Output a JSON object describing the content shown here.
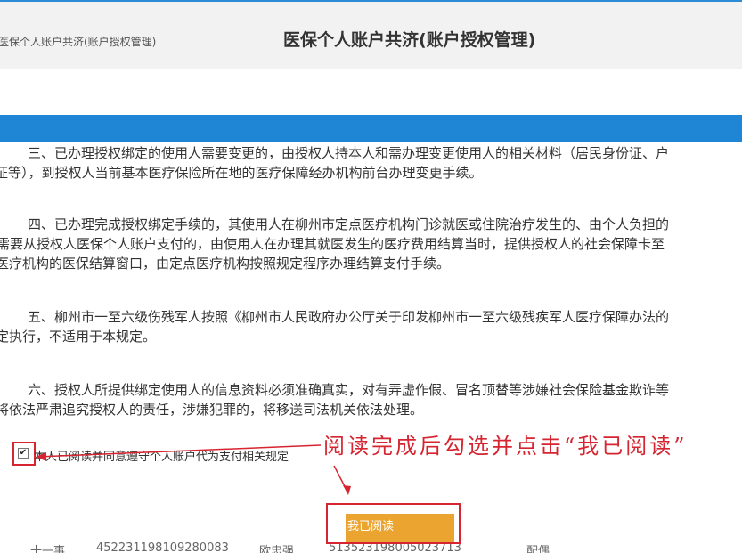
{
  "header": {
    "breadcrumb": "医保个人账户共济(账户授权管理)",
    "title": "医保个人账户共济(账户授权管理)"
  },
  "paragraphs": [
    {
      "lines": [
        "三、已办理授权绑定的使用人需要变更的，由授权人持本人和需办理变更使用人的相关材料（居民身份证、户",
        "证等），到授权人当前基本医疗保险所在地的医疗保障经办机构前台办理变更手续。"
      ]
    },
    {
      "lines": [
        "四、已办理完成授权绑定手续的，其使用人在柳州市定点医疗机构门诊就医或住院治疗发生的、由个人负担的",
        "需要从授权人医保个人账户支付的，由使用人在办理其就医发生的医疗费用结算当时，提供授权人的社会保障卡至",
        "医疗机构的医保结算窗口，由定点医疗机构按照规定程序办理结算支付手续。"
      ]
    },
    {
      "lines": [
        "五、柳州市一至六级伤残军人按照《柳州市人民政府办公厅关于印发柳州市一至六级残疾军人医疗保障办法的",
        "定执行，不适用于本规定。"
      ]
    },
    {
      "lines": [
        "六、授权人所提供绑定使用人的信息资料必须准确真实，对有弄虚作假、冒名顶替等涉嫌社会保险基金欺诈等",
        "将依法严肃追究授权人的责任，涉嫌犯罪的，将移送司法机关依法处理。"
      ]
    }
  ],
  "agreement": {
    "label": "本人已阅读并同意遵守个人账户代为支付相关规定",
    "checked": true
  },
  "annotation": "阅读完成后勾选并点击“我已阅读”",
  "read_button": {
    "label": "我已阅读"
  },
  "table_peek": [
    "十一事",
    "452231198109280083",
    "欧忠强",
    "513523198005023713",
    "配偶"
  ],
  "colors": {
    "accent_blue": "#1f86d6",
    "button_orange": "#eba42f",
    "annotation_red": "#d62430"
  }
}
